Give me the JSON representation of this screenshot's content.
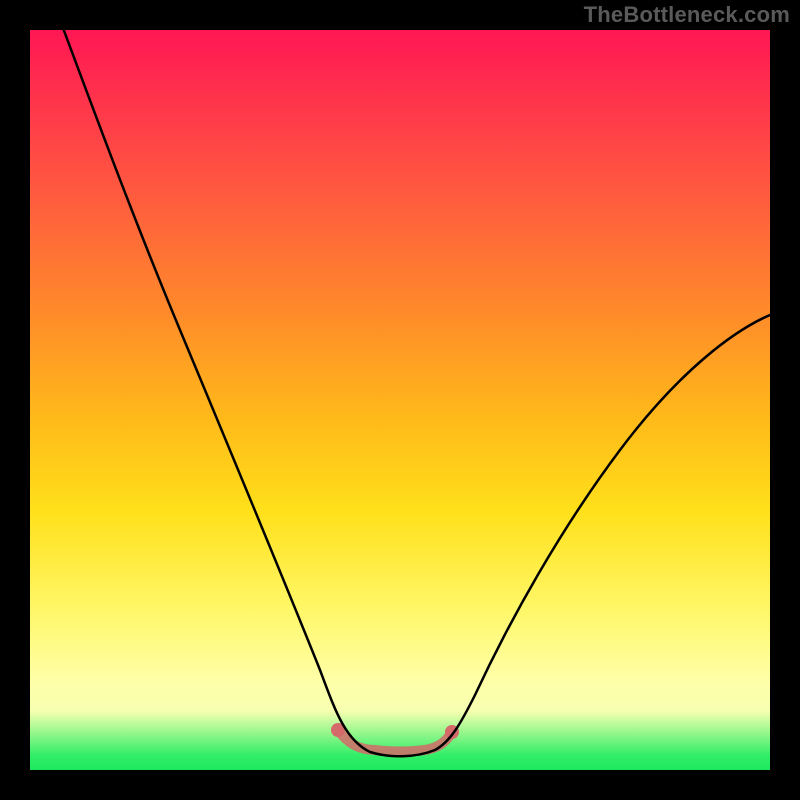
{
  "watermark": "TheBottleneck.com",
  "chart_data": {
    "type": "line",
    "title": "",
    "xlabel": "",
    "ylabel": "",
    "x": [
      0.0,
      0.05,
      0.1,
      0.15,
      0.2,
      0.25,
      0.3,
      0.35,
      0.4,
      0.42,
      0.44,
      0.46,
      0.48,
      0.5,
      0.52,
      0.54,
      0.56,
      0.6,
      0.65,
      0.7,
      0.75,
      0.8,
      0.85,
      0.9,
      0.95,
      1.0
    ],
    "values": [
      1.0,
      0.89,
      0.78,
      0.67,
      0.56,
      0.45,
      0.33,
      0.22,
      0.1,
      0.05,
      0.02,
      0.01,
      0.01,
      0.01,
      0.01,
      0.02,
      0.05,
      0.12,
      0.2,
      0.27,
      0.34,
      0.4,
      0.46,
      0.51,
      0.56,
      0.6
    ],
    "xlim": [
      0,
      1
    ],
    "ylim": [
      0,
      1
    ],
    "background_gradient": {
      "direction": "vertical",
      "stops": [
        {
          "pos": 0.0,
          "color": "#ff1753"
        },
        {
          "pos": 0.3,
          "color": "#ff8a2a"
        },
        {
          "pos": 0.6,
          "color": "#ffe01a"
        },
        {
          "pos": 0.9,
          "color": "#ffffa8"
        },
        {
          "pos": 1.0,
          "color": "#1ee85f"
        }
      ]
    },
    "trough_highlight": {
      "x_range": [
        0.42,
        0.56
      ],
      "color": "#d46a6a"
    }
  }
}
